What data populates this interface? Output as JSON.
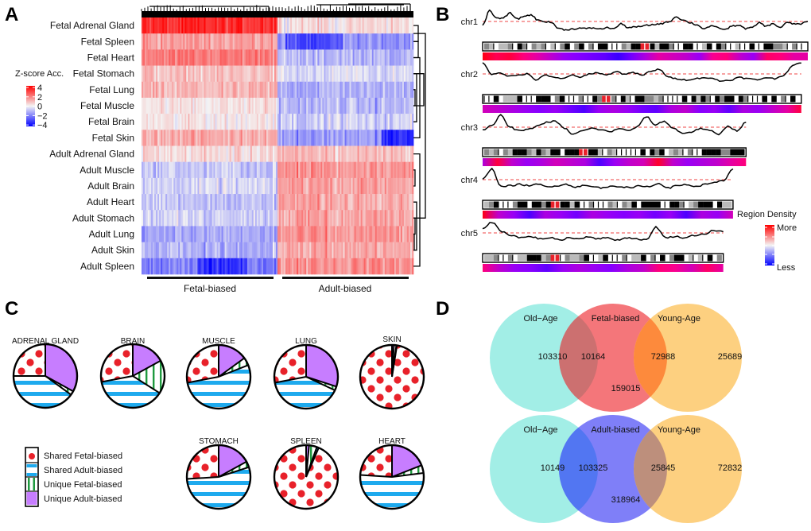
{
  "panels": {
    "A": "A",
    "B": "B",
    "C": "C",
    "D": "D"
  },
  "chart_data": [
    {
      "panel": "A",
      "type": "heatmap",
      "title": "",
      "rows": [
        "Fetal Adrenal Gland",
        "Fetal Spleen",
        "Fetal Heart",
        "Fetal Stomach",
        "Fetal Lung",
        "Fetal Muscle",
        "Fetal Brain",
        "Fetal Skin",
        "Adult Adrenal Gland",
        "Adult Muscle",
        "Adult Brain",
        "Adult Heart",
        "Adult Stomach",
        "Adult Lung",
        "Adult Skin",
        "Adult Spleen"
      ],
      "column_groups": [
        {
          "label": "Fetal-biased",
          "fraction": 0.5
        },
        {
          "label": "Adult-biased",
          "fraction": 0.5
        }
      ],
      "group_means": [
        [
          3.2,
          0.4
        ],
        [
          1.4,
          -1.6
        ],
        [
          2.0,
          -1.0
        ],
        [
          0.8,
          -0.5
        ],
        [
          0.9,
          -1.1
        ],
        [
          0.3,
          -1.0
        ],
        [
          0.2,
          -0.6
        ],
        [
          1.2,
          -1.4
        ],
        [
          0.4,
          0.9
        ],
        [
          -0.7,
          1.6
        ],
        [
          -0.5,
          1.4
        ],
        [
          -0.8,
          1.3
        ],
        [
          -0.5,
          1.3
        ],
        [
          -1.2,
          1.5
        ],
        [
          -1.1,
          1.2
        ],
        [
          -1.9,
          1.7
        ]
      ],
      "legend": {
        "title": "Z-score Acc.",
        "ticks": [
          "4",
          "2",
          "0",
          "−2",
          "−4"
        ],
        "range": [
          -4,
          4
        ],
        "colors": {
          "high": "#ff0000",
          "mid": "#f4f4f4",
          "low": "#0000ff"
        }
      },
      "dendrogram": {
        "columns": true,
        "rows": true
      }
    },
    {
      "panel": "B",
      "type": "line",
      "title": "",
      "chromosomes": [
        {
          "name": "chr1",
          "length": 1.0,
          "profile": [
            0.35,
            0.95,
            0.62,
            0.66,
            0.85,
            0.6,
            0.72,
            0.78,
            0.55,
            0.5,
            0.45,
            0.2,
            0.15,
            0.18,
            0.22,
            0.2,
            0.23,
            0.18,
            0.24,
            0.2,
            0.4,
            0.25,
            0.26,
            0.3,
            0.34,
            0.38,
            0.42,
            0.5,
            0.7,
            0.55,
            0.45,
            0.35,
            0.2,
            0.3,
            0.25,
            0.15,
            0.3,
            0.35,
            0.2,
            0.25,
            0.45,
            0.3,
            0.4,
            0.25,
            0.45,
            0.4,
            0.4,
            0.5
          ],
          "density": [
            0.95,
            0.8,
            0.85,
            0.7,
            0.6,
            0.5,
            0.4,
            0.35,
            0.3,
            0.25,
            0.15,
            0.3,
            0.45,
            0.6,
            0.55,
            0.5,
            0.4,
            0.65,
            0.7,
            0.5,
            0.4,
            0.75,
            0.7,
            0.6,
            0.6
          ]
        },
        {
          "name": "chr2",
          "length": 0.98,
          "profile": [
            0.95,
            0.5,
            0.55,
            0.4,
            0.45,
            0.5,
            0.25,
            0.45,
            0.35,
            0.3,
            0.45,
            0.35,
            0.5,
            0.55,
            0.45,
            0.6,
            0.5,
            0.55,
            0.45,
            0.6,
            0.7,
            0.35,
            0.3,
            0.25,
            0.3,
            0.35,
            0.3,
            0.2,
            0.25,
            0.35,
            0.3,
            0.25,
            0.35,
            0.3,
            0.45,
            0.85,
            0.95
          ],
          "density": [
            0.55,
            0.5,
            0.45,
            0.4,
            0.35,
            0.4,
            0.3,
            0.2,
            0.4,
            0.45,
            0.4,
            0.3,
            0.25,
            0.45,
            0.5,
            0.35,
            0.4,
            0.25,
            0.45,
            0.4,
            0.5,
            0.6,
            0.85
          ]
        },
        {
          "name": "chr3",
          "length": 0.81,
          "profile": [
            0.4,
            0.55,
            1.0,
            0.5,
            0.35,
            0.4,
            0.55,
            0.7,
            0.75,
            0.45,
            0.2,
            0.35,
            0.45,
            0.4,
            0.3,
            0.45,
            0.35,
            0.5,
            0.95,
            0.6,
            0.75,
            0.45,
            0.25,
            0.3,
            0.45,
            0.35,
            0.2,
            0.55,
            0.35,
            0.7
          ],
          "density": [
            0.45,
            0.85,
            0.5,
            0.4,
            0.45,
            0.55,
            0.5,
            0.45,
            0.2,
            0.4,
            0.5,
            0.55,
            0.9,
            0.5,
            0.4,
            0.45,
            0.5,
            0.6,
            0.7
          ]
        },
        {
          "name": "chr4",
          "length": 0.77,
          "profile": [
            0.55,
            0.95,
            0.2,
            0.25,
            0.3,
            0.25,
            0.3,
            0.2,
            0.25,
            0.3,
            0.2,
            0.25,
            0.2,
            0.15,
            0.25,
            0.2,
            0.15,
            0.25,
            0.2,
            0.35,
            0.15,
            0.25,
            0.3,
            0.2,
            0.3,
            0.4,
            0.45,
            0.95
          ],
          "density": [
            0.95,
            0.5,
            0.4,
            0.2,
            0.45,
            0.4,
            0.3,
            0.45,
            0.4,
            0.35,
            0.4,
            0.3,
            0.4,
            0.2,
            0.45,
            0.4,
            0.55
          ]
        },
        {
          "name": "chr5",
          "length": 0.74,
          "profile": [
            0.7,
            0.95,
            0.55,
            0.4,
            0.3,
            0.35,
            0.25,
            0.3,
            0.2,
            0.3,
            0.25,
            0.35,
            0.25,
            0.3,
            0.2,
            0.3,
            0.25,
            0.2,
            0.75,
            0.3,
            0.35,
            0.3,
            0.4,
            0.45,
            0.6,
            0.55
          ],
          "density": [
            0.7,
            0.5,
            0.4,
            0.35,
            0.25,
            0.4,
            0.45,
            0.4,
            0.35,
            0.45,
            0.5,
            0.7,
            0.65,
            0.55,
            0.75,
            0.6
          ]
        }
      ],
      "threshold": 0.5,
      "legend": {
        "title": "Region Density",
        "high_label": "More",
        "low_label": "Less",
        "colors": {
          "high": "#ff0000",
          "mid": "#f4f4f4",
          "low": "#0000ff"
        }
      },
      "line_color": "#000000",
      "threshold_color": "#f26a6a"
    },
    {
      "panel": "C",
      "type": "pie",
      "categories": [
        "Unique Adult-biased",
        "Unique Fetal-biased",
        "Shared Adult-biased",
        "Shared Fetal-biased"
      ],
      "legend_order": [
        "Shared Fetal-biased",
        "Shared Adult-biased",
        "Unique Fetal-biased",
        "Unique Adult-biased"
      ],
      "colors": {
        "Unique Adult-biased": "#c77dff",
        "Unique Fetal-biased": "#1f9a3f",
        "Shared Adult-biased": "#1eaaee",
        "Shared Fetal-biased": "#e8212a"
      },
      "pies": [
        {
          "title": "ADRENAL GLAND",
          "values": [
            0.33,
            0.02,
            0.4,
            0.25
          ]
        },
        {
          "title": "BRAIN",
          "values": [
            0.17,
            0.17,
            0.38,
            0.28
          ]
        },
        {
          "title": "MUSCLE",
          "values": [
            0.15,
            0.04,
            0.53,
            0.28
          ]
        },
        {
          "title": "LUNG",
          "values": [
            0.3,
            0.02,
            0.4,
            0.28
          ]
        },
        {
          "title": "SKIN",
          "values": [
            0.01,
            0.012,
            0.003,
            0.975
          ]
        },
        {
          "title": "STOMACH",
          "values": [
            0.17,
            0.03,
            0.54,
            0.26
          ]
        },
        {
          "title": "SPLEEN",
          "values": [
            0.015,
            0.04,
            0.01,
            0.935
          ]
        },
        {
          "title": "HEART",
          "values": [
            0.19,
            0.04,
            0.53,
            0.24
          ]
        }
      ]
    },
    {
      "panel": "D",
      "type": "venn",
      "diagrams": [
        {
          "sets": [
            "Old−Age",
            "Fetal-biased",
            "Young-Age"
          ],
          "colors": [
            "#a2eee6",
            "#f4767a",
            "#fdd080"
          ],
          "overlap_colors": [
            "#cc7070",
            "#fd8a3c"
          ],
          "regions": {
            "left_only": "103310",
            "left_center": "10164",
            "center_only": "159015",
            "center_right": "72988",
            "right_only": "25689"
          }
        },
        {
          "sets": [
            "Old−Age",
            "Adult-biased",
            "Young-Age"
          ],
          "colors": [
            "#a2eee6",
            "#7f7ff8",
            "#fdd080"
          ],
          "overlap_colors": [
            "#5276f2",
            "#bd8f7c"
          ],
          "regions": {
            "left_only": "10149",
            "left_center": "103325",
            "center_only": "318964",
            "center_right": "25845",
            "right_only": "72832"
          }
        }
      ]
    }
  ]
}
